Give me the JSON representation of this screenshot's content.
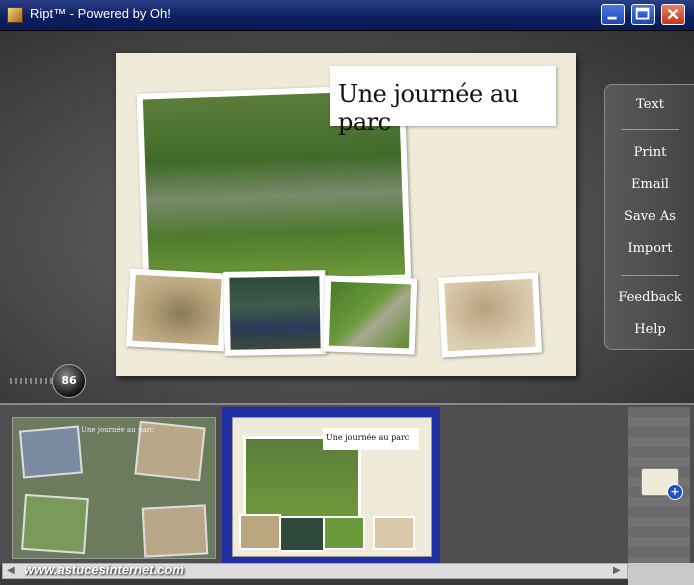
{
  "window": {
    "title": "Ript™ - Powered by Oh!",
    "minimize_icon": "minimize-icon",
    "maximize_icon": "maximize-icon",
    "close_icon": "close-icon"
  },
  "page": {
    "title": "Une journée au parc",
    "photos": [
      "palm-garden-photo",
      "tortoise-photo",
      "cassowary-photo",
      "garden-path-photo",
      "meerkat-photo"
    ]
  },
  "side_menu": {
    "items": [
      "Text",
      "Print",
      "Email",
      "Save As",
      "Import",
      "Feedback",
      "Help"
    ]
  },
  "zoom": {
    "value": "86"
  },
  "filmstrip": {
    "thumb1_title": "Une journée au parc",
    "thumb2_title": "Une journée au parc",
    "add_page_icon": "add-page-icon"
  },
  "watermark": "www.astucesinternet.com",
  "colors": {
    "titlebar": "#0b1d5c",
    "selection": "#1f2fa0",
    "card": "#efebd8"
  }
}
